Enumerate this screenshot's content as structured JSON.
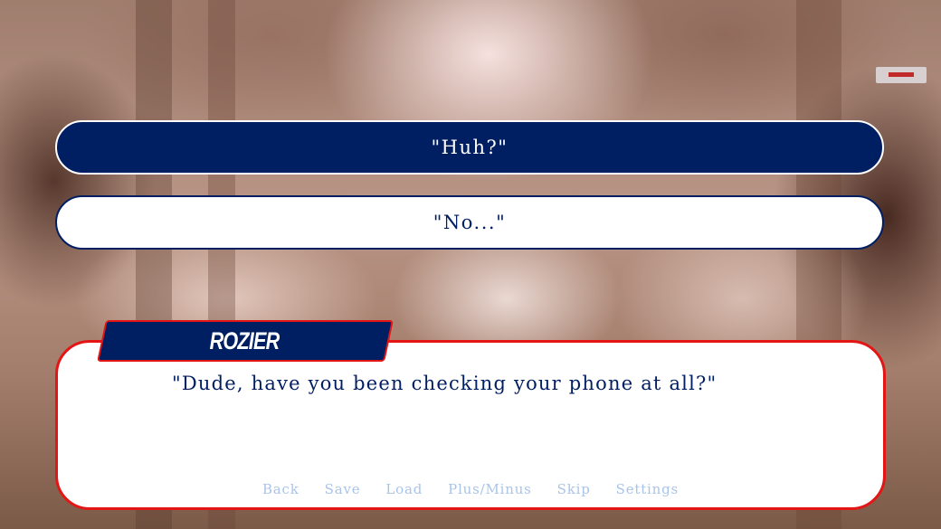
{
  "choices": [
    {
      "label": "\"Huh?\"",
      "state": "hovered"
    },
    {
      "label": "\"No...\"",
      "state": "idle"
    }
  ],
  "dialogue": {
    "speaker": "ROZIER",
    "text": "\"Dude, have you been checking your phone at all?\""
  },
  "quick_menu": [
    {
      "label": "Back"
    },
    {
      "label": "Save"
    },
    {
      "label": "Load"
    },
    {
      "label": "Plus/Minus"
    },
    {
      "label": "Skip"
    },
    {
      "label": "Settings"
    }
  ],
  "colors": {
    "primary_navy": "#001e62",
    "accent_red": "#e41515",
    "quick_menu_text": "#a9c4ea",
    "panel_white": "#ffffff"
  }
}
